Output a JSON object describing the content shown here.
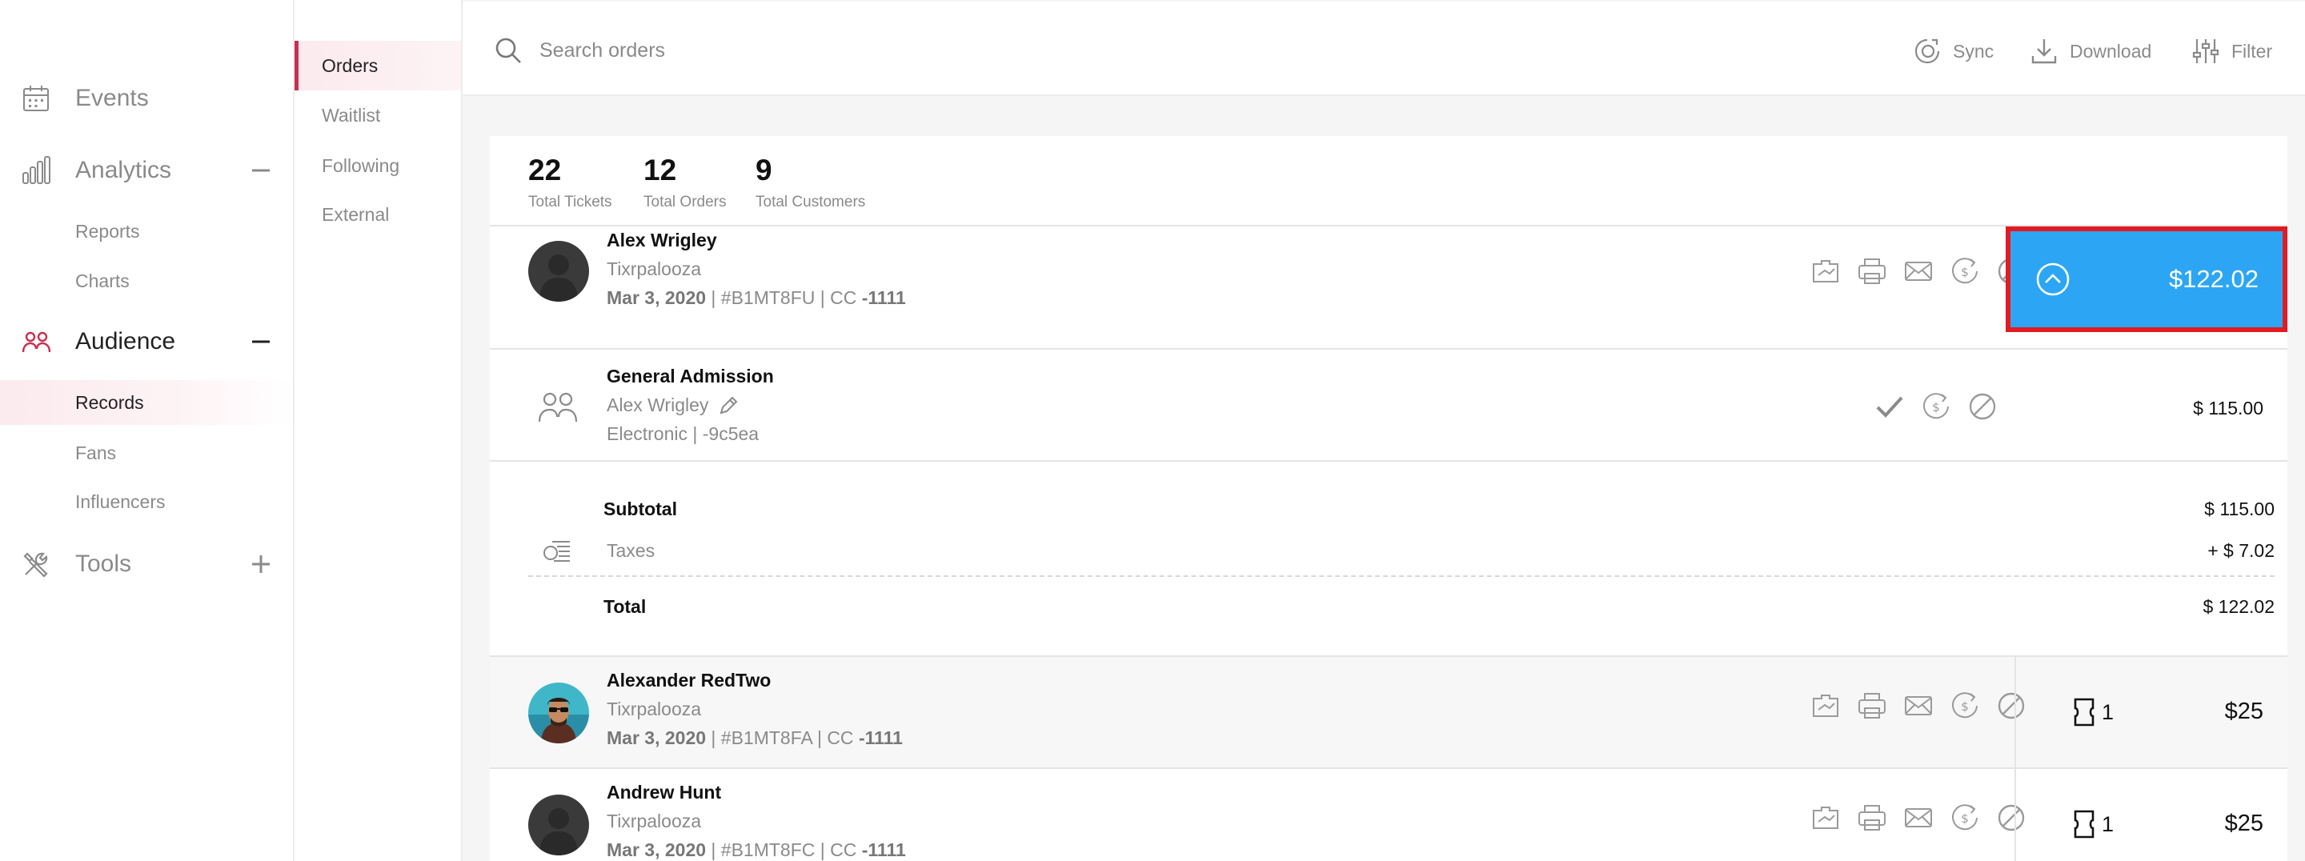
{
  "nav": {
    "items": [
      {
        "label": "Events"
      },
      {
        "label": "Analytics"
      },
      {
        "label": "Audience"
      },
      {
        "label": "Tools"
      }
    ],
    "analytics_sub": [
      "Reports",
      "Charts"
    ],
    "audience_sub": [
      "Records",
      "Fans",
      "Influencers"
    ]
  },
  "subnav": [
    "Orders",
    "Waitlist",
    "Following",
    "External"
  ],
  "topbar": {
    "search_placeholder": "Search orders",
    "sync": "Sync",
    "download": "Download",
    "filter": "Filter"
  },
  "stats": [
    {
      "value": "22",
      "label": "Total Tickets"
    },
    {
      "value": "12",
      "label": "Total Orders"
    },
    {
      "value": "9",
      "label": "Total Customers"
    }
  ],
  "orders": [
    {
      "name": "Alex Wrigley",
      "event": "Tixrpalooza",
      "date": "Mar 3, 2020",
      "meta": " | #B1MT8FU | CC ",
      "card": "-1111",
      "total": "$122.02"
    },
    {
      "name": "Alexander RedTwo",
      "event": "Tixrpalooza",
      "date": "Mar 3, 2020",
      "meta": " | #B1MT8FA | CC ",
      "card": "-1111",
      "tickets": "1",
      "total": "$25"
    },
    {
      "name": "Andrew Hunt",
      "event": "Tixrpalooza",
      "date": "Mar 3, 2020",
      "meta": " | #B1MT8FC | CC ",
      "card": "-1111",
      "tickets": "1",
      "total": "$25"
    }
  ],
  "ticket": {
    "title": "General Admission",
    "holder": "Alex Wrigley",
    "type": "Electronic | -9c5ea",
    "price": "$ 115.00"
  },
  "summary": {
    "subtotal_label": "Subtotal",
    "subtotal": "$ 115.00",
    "taxes_label": "Taxes",
    "taxes": "+ $ 7.02",
    "total_label": "Total",
    "total": "$ 122.02"
  },
  "colors": {
    "accent": "#c9304e",
    "price_button": "#2ca6f4",
    "highlight_border": "#e21b23"
  }
}
